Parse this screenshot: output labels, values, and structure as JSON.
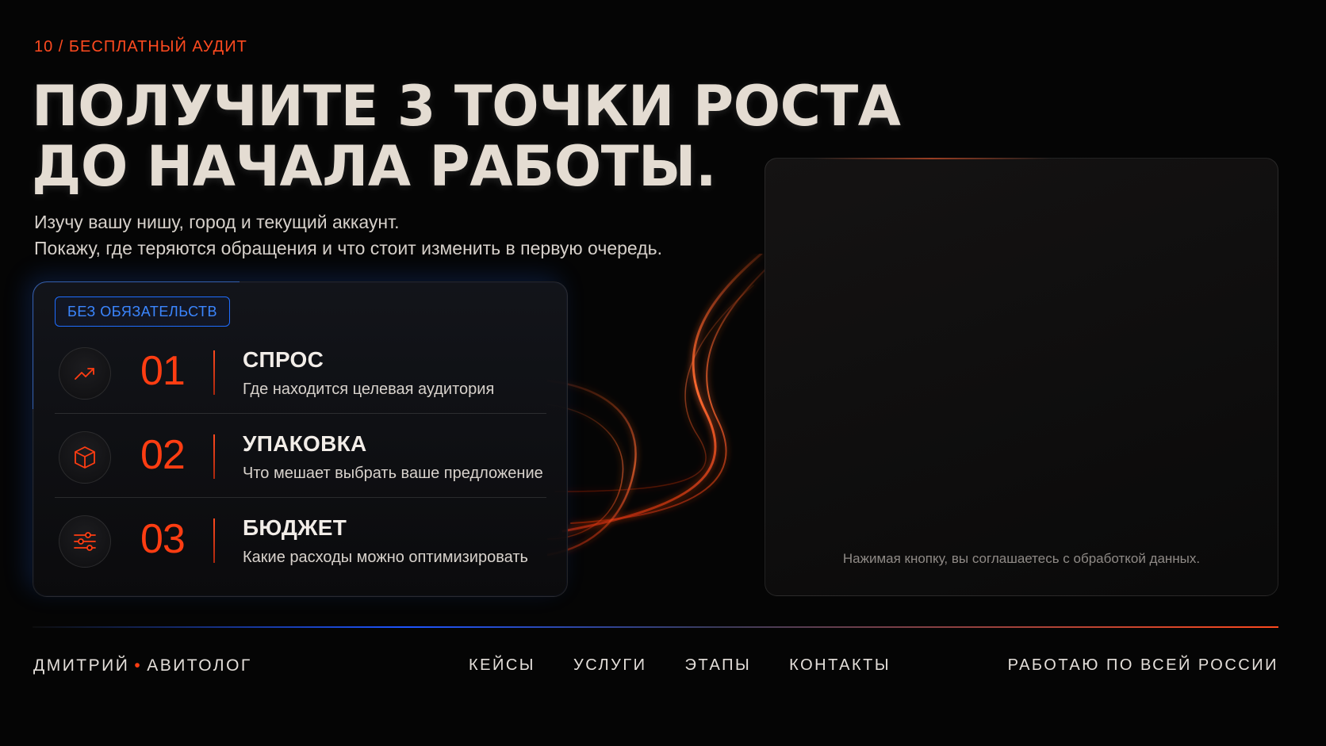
{
  "eyebrow": "10 / БЕСПЛАТНЫЙ АУДИТ",
  "headline": {
    "line1": "ПОЛУЧИТЕ 3 ТОЧКИ РОСТА",
    "line2": "ДО НАЧАЛА РАБОТЫ."
  },
  "subtitle": {
    "line1": "Изучу вашу нишу, город и текущий аккаунт.",
    "line2": "Покажу, где теряются обращения и что стоит изменить в первую очередь."
  },
  "card": {
    "badge": "БЕЗ ОБЯЗАТЕЛЬСТВ",
    "items": [
      {
        "number": "01",
        "title": "СПРОС",
        "description": "Где находится целевая аудитория",
        "icon": "trend-up-icon"
      },
      {
        "number": "02",
        "title": "УПАКОВКА",
        "description": "Что мешает выбрать ваше предложение",
        "icon": "box-icon"
      },
      {
        "number": "03",
        "title": "БЮДЖЕТ",
        "description": "Какие расходы можно оптимизировать",
        "icon": "sliders-icon"
      }
    ]
  },
  "panel": {
    "consent": "Нажимая кнопку, вы соглашаетесь с обработкой данных."
  },
  "footer": {
    "brand_name": "ДМИТРИЙ",
    "brand_dot": "•",
    "brand_role": "АВИТОЛОГ",
    "nav": [
      "КЕЙСЫ",
      "УСЛУГИ",
      "ЭТАПЫ",
      "КОНТАКТЫ"
    ],
    "region": "РАБОТАЮ ПО ВСЕЙ РОССИИ"
  },
  "colors": {
    "accent": "#ff3d12",
    "badge_blue": "#1f6dff",
    "background": "#050505"
  }
}
